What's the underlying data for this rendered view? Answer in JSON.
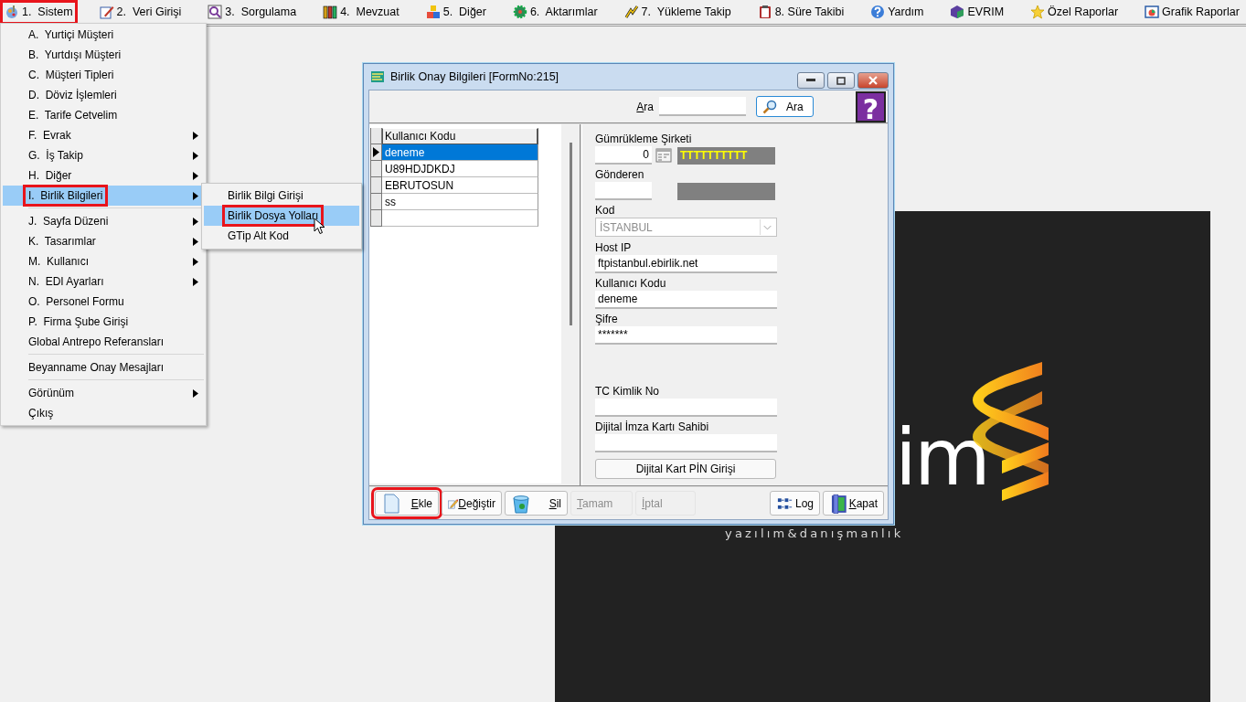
{
  "menubar": [
    {
      "label": "1.  Sistem",
      "highlighted": true
    },
    {
      "label": "2.  Veri Girişi",
      "highlighted": false
    },
    {
      "label": "3.  Sorgulama",
      "highlighted": false
    },
    {
      "label": "4.  Mevzuat",
      "highlighted": false
    },
    {
      "label": "5.  Diğer",
      "highlighted": false
    },
    {
      "label": "6.  Aktarımlar",
      "highlighted": false
    },
    {
      "label": "7.  Yükleme Takip",
      "highlighted": false
    },
    {
      "label": "8. Süre Takibi",
      "highlighted": false
    },
    {
      "label": "Yardım",
      "highlighted": false
    },
    {
      "label": "EVRIM",
      "highlighted": false
    },
    {
      "label": "Özel Raporlar",
      "highlighted": false
    },
    {
      "label": "Grafik Raporlar",
      "highlighted": false
    }
  ],
  "menu": {
    "groups": [
      [
        {
          "label": "A.  Yurtiçi Müşteri",
          "submenu": false,
          "selected": false,
          "highlighted": false
        },
        {
          "label": "B.  Yurtdışı Müşteri",
          "submenu": false,
          "selected": false,
          "highlighted": false
        },
        {
          "label": "C.  Müşteri Tipleri",
          "submenu": false,
          "selected": false,
          "highlighted": false
        },
        {
          "label": "D.  Döviz İşlemleri",
          "submenu": false,
          "selected": false,
          "highlighted": false
        },
        {
          "label": "E.  Tarife Cetvelim",
          "submenu": false,
          "selected": false,
          "highlighted": false
        },
        {
          "label": "F.  Evrak",
          "submenu": true,
          "selected": false,
          "highlighted": false
        },
        {
          "label": "G.  İş Takip",
          "submenu": true,
          "selected": false,
          "highlighted": false
        },
        {
          "label": "H.  Diğer",
          "submenu": true,
          "selected": false,
          "highlighted": false
        },
        {
          "label": "I.  Birlik Bilgileri",
          "submenu": true,
          "selected": true,
          "highlighted": true
        }
      ],
      [
        {
          "label": "J.  Sayfa Düzeni",
          "submenu": true,
          "selected": false,
          "highlighted": false
        },
        {
          "label": "K.  Tasarımlar",
          "submenu": true,
          "selected": false,
          "highlighted": false
        },
        {
          "label": "M.  Kullanıcı",
          "submenu": true,
          "selected": false,
          "highlighted": false
        },
        {
          "label": "N.  EDI Ayarları",
          "submenu": true,
          "selected": false,
          "highlighted": false
        },
        {
          "label": "O.  Personel Formu",
          "submenu": false,
          "selected": false,
          "highlighted": false
        },
        {
          "label": "P.  Firma Şube Girişi",
          "submenu": false,
          "selected": false,
          "highlighted": false
        },
        {
          "label": "Global Antrepo Referansları",
          "submenu": false,
          "selected": false,
          "highlighted": false
        }
      ],
      [
        {
          "label": "Beyanname Onay Mesajları",
          "submenu": false,
          "selected": false,
          "highlighted": false
        }
      ],
      [
        {
          "label": "Görünüm",
          "submenu": true,
          "selected": false,
          "highlighted": false
        },
        {
          "label": "Çıkış",
          "submenu": false,
          "selected": false,
          "highlighted": false
        }
      ]
    ]
  },
  "submenu": {
    "items": [
      {
        "label": "Birlik Bilgi Girişi",
        "selected": false,
        "highlighted": false
      },
      {
        "label": "Birlik Dosya Yolları",
        "selected": true,
        "highlighted": true
      },
      {
        "label": "GTip Alt Kod",
        "selected": false,
        "highlighted": false
      }
    ]
  },
  "splash": {
    "logo_text": "im",
    "tagline": "yazılım&danışmanlık"
  },
  "dialog": {
    "title": "Birlik Onay Bilgileri [FormNo:215]",
    "search": {
      "label": "Ara",
      "mnemonic": true,
      "button": "Ara"
    },
    "help_button": "?",
    "grid": {
      "columns": [
        "Kullanıcı Kodu"
      ],
      "rows": [
        {
          "cells": [
            "deneme"
          ],
          "selected": true
        },
        {
          "cells": [
            "U89HDJDKDJ"
          ],
          "selected": false
        },
        {
          "cells": [
            "EBRUTOSUN"
          ],
          "selected": false
        },
        {
          "cells": [
            "ss"
          ],
          "selected": false
        }
      ]
    },
    "form": {
      "sections": [
        [
          {
            "kind": "lookup",
            "label": "Gümrükleme Şirketi",
            "code": "0",
            "picker": true,
            "name": "TTTTTTTTTT"
          },
          {
            "kind": "lookup",
            "label": "Gönderen",
            "picker": false
          },
          {
            "kind": "select",
            "label": "Kod",
            "value": "İSTANBUL",
            "disabled": true
          },
          {
            "kind": "text",
            "label": "Host IP",
            "value": "ftpistanbul.ebirlik.net"
          },
          {
            "kind": "text",
            "label": "Kullanıcı Kodu",
            "value": "deneme"
          },
          {
            "kind": "text",
            "label": "Şifre",
            "value": "*******"
          }
        ],
        [
          {
            "kind": "text",
            "label": "TC Kimlik No"
          },
          {
            "kind": "text",
            "label": "Dijital İmza Kartı Sahibi"
          }
        ]
      ],
      "pin_button": "Dijital Kart PİN Girişi"
    },
    "buttons_left": [
      {
        "label": "Ekle",
        "mnemonic": true,
        "disabled": false,
        "highlighted": true
      },
      {
        "label": "Değiştir",
        "mnemonic": true,
        "disabled": false,
        "highlighted": false
      },
      {
        "label": "Sil",
        "mnemonic": true,
        "disabled": false,
        "highlighted": false
      },
      {
        "label": "Tamam",
        "mnemonic": true,
        "disabled": true,
        "highlighted": false
      },
      {
        "label": "İptal",
        "mnemonic": true,
        "disabled": true,
        "highlighted": false
      }
    ],
    "buttons_right": [
      {
        "label": "Log",
        "mnemonic": false,
        "disabled": false,
        "highlighted": false
      },
      {
        "label": "Kapat",
        "mnemonic": true,
        "disabled": false,
        "highlighted": false
      }
    ]
  }
}
